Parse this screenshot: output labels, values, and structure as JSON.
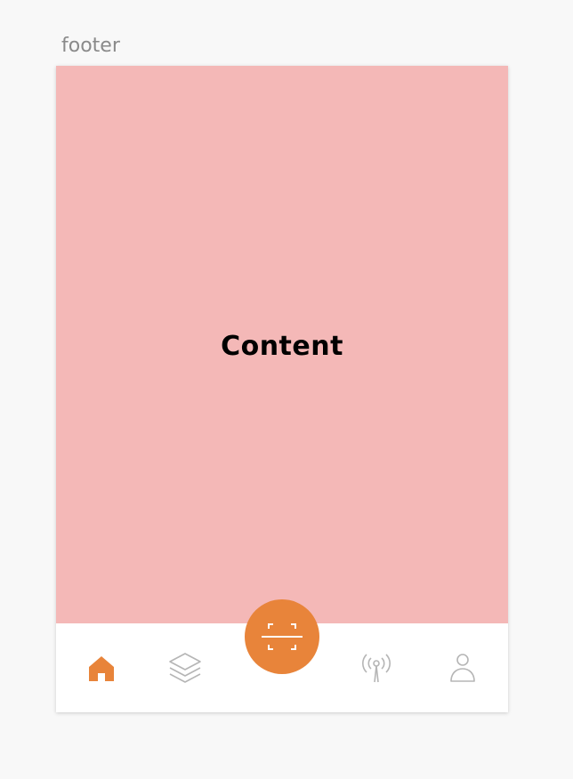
{
  "frame": {
    "title": "footer"
  },
  "content": {
    "label": "Content",
    "background": "#f4b8b7"
  },
  "footer": {
    "accent_color": "#e8843a",
    "inactive_color": "#b5b5b5",
    "items": [
      {
        "icon": "home-icon",
        "active": true
      },
      {
        "icon": "layers-icon",
        "active": false
      },
      {
        "icon": "scan-icon",
        "active": false,
        "primary": true
      },
      {
        "icon": "broadcast-icon",
        "active": false
      },
      {
        "icon": "user-icon",
        "active": false
      }
    ]
  }
}
